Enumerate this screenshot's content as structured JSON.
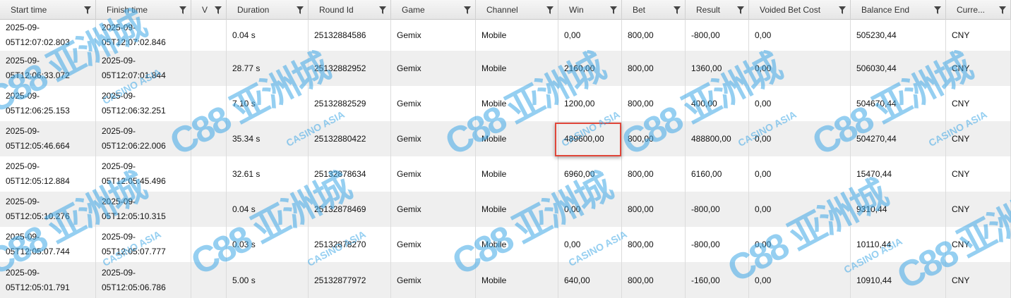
{
  "columns": [
    {
      "key": "start",
      "label": "Start time"
    },
    {
      "key": "finish",
      "label": "Finish time"
    },
    {
      "key": "v",
      "label": "V"
    },
    {
      "key": "duration",
      "label": "Duration"
    },
    {
      "key": "round",
      "label": "Round Id"
    },
    {
      "key": "game",
      "label": "Game"
    },
    {
      "key": "channel",
      "label": "Channel"
    },
    {
      "key": "win",
      "label": "Win"
    },
    {
      "key": "bet",
      "label": "Bet"
    },
    {
      "key": "result",
      "label": "Result"
    },
    {
      "key": "voided",
      "label": "Voided Bet Cost"
    },
    {
      "key": "balance",
      "label": "Balance End"
    },
    {
      "key": "currency",
      "label": "Curre..."
    }
  ],
  "rows": [
    {
      "start": [
        "2025-09-",
        "05T12:07:02.803"
      ],
      "finish": [
        "2025-09-",
        "05T12:07:02.846"
      ],
      "v": "",
      "duration": "0.04 s",
      "round": "25132884586",
      "game": "Gemix",
      "channel": "Mobile",
      "win": "0,00",
      "bet": "800,00",
      "result": "-800,00",
      "voided": "0,00",
      "balance": "505230,44",
      "currency": "CNY"
    },
    {
      "start": [
        "2025-09-",
        "05T12:06:33.072"
      ],
      "finish": [
        "2025-09-",
        "05T12:07:01.844"
      ],
      "v": "",
      "duration": "28.77 s",
      "round": "25132882952",
      "game": "Gemix",
      "channel": "Mobile",
      "win": "2160,00",
      "bet": "800,00",
      "result": "1360,00",
      "voided": "0,00",
      "balance": "506030,44",
      "currency": "CNY"
    },
    {
      "start": [
        "2025-09-",
        "05T12:06:25.153"
      ],
      "finish": [
        "2025-09-",
        "05T12:06:32.251"
      ],
      "v": "",
      "duration": "7.10 s",
      "round": "25132882529",
      "game": "Gemix",
      "channel": "Mobile",
      "win": "1200,00",
      "bet": "800,00",
      "result": "400,00",
      "voided": "0,00",
      "balance": "504670,44",
      "currency": "CNY"
    },
    {
      "start": [
        "2025-09-",
        "05T12:05:46.664"
      ],
      "finish": [
        "2025-09-",
        "05T12:06:22.006"
      ],
      "v": "",
      "duration": "35.34 s",
      "round": "25132880422",
      "game": "Gemix",
      "channel": "Mobile",
      "win": "489600,00",
      "bet": "800,00",
      "result": "488800,00",
      "voided": "0,00",
      "balance": "504270,44",
      "currency": "CNY"
    },
    {
      "start": [
        "2025-09-",
        "05T12:05:12.884"
      ],
      "finish": [
        "2025-09-",
        "05T12:05:45.496"
      ],
      "v": "",
      "duration": "32.61 s",
      "round": "25132878634",
      "game": "Gemix",
      "channel": "Mobile",
      "win": "6960,00",
      "bet": "800,00",
      "result": "6160,00",
      "voided": "0,00",
      "balance": "15470,44",
      "currency": "CNY"
    },
    {
      "start": [
        "2025-09-",
        "05T12:05:10.276"
      ],
      "finish": [
        "2025-09-",
        "05T12:05:10.315"
      ],
      "v": "",
      "duration": "0.04 s",
      "round": "25132878469",
      "game": "Gemix",
      "channel": "Mobile",
      "win": "0,00",
      "bet": "800,00",
      "result": "-800,00",
      "voided": "0,00",
      "balance": "9310,44",
      "currency": "CNY"
    },
    {
      "start": [
        "2025-09-",
        "05T12:05:07.744"
      ],
      "finish": [
        "2025-09-",
        "05T12:05:07.777"
      ],
      "v": "",
      "duration": "0.03 s",
      "round": "25132878270",
      "game": "Gemix",
      "channel": "Mobile",
      "win": "0,00",
      "bet": "800,00",
      "result": "-800,00",
      "voided": "0,00",
      "balance": "10110,44",
      "currency": "CNY"
    },
    {
      "start": [
        "2025-09-",
        "05T12:05:01.791"
      ],
      "finish": [
        "2025-09-",
        "05T12:05:06.786"
      ],
      "v": "",
      "duration": "5.00 s",
      "round": "25132877972",
      "game": "Gemix",
      "channel": "Mobile",
      "win": "640,00",
      "bet": "800,00",
      "result": "-160,00",
      "voided": "0,00",
      "balance": "10910,44",
      "currency": "CNY"
    }
  ],
  "watermark": {
    "logo": "C88 亚洲城",
    "sub": "CASINO ASIA",
    "color": "#3fa8e6"
  },
  "highlight_color": "#e0463a"
}
